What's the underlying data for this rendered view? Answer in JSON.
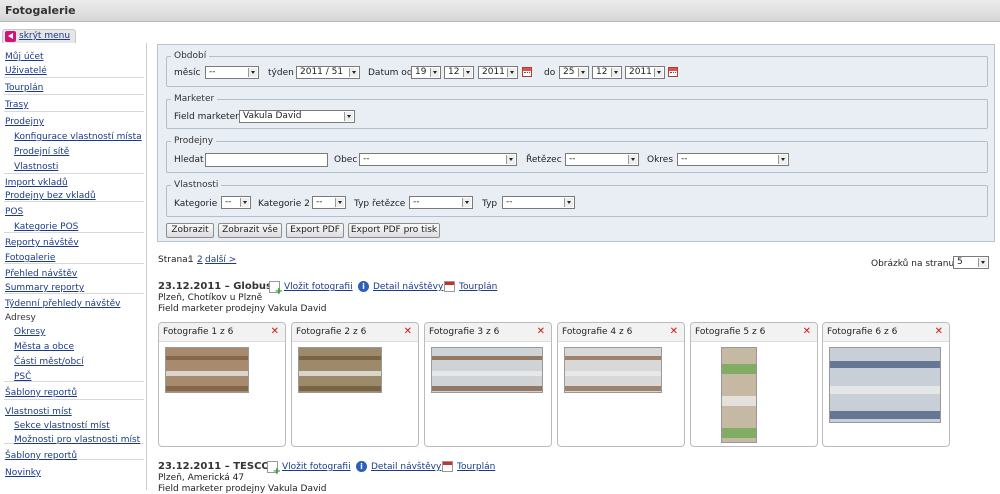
{
  "app": {
    "title": "Fotogalerie"
  },
  "sidebar": {
    "hide_label": "skrýt menu",
    "items": [
      {
        "label": "Můj účet",
        "link": true,
        "indent": false
      },
      {
        "label": "Uživatelé",
        "link": true,
        "indent": false
      },
      {
        "label": "Tourplán",
        "link": true,
        "indent": false
      },
      {
        "label": "Trasy",
        "link": true,
        "indent": false
      },
      {
        "label": "Prodejny",
        "link": true,
        "indent": false
      },
      {
        "label": "Konfigurace vlastností místa",
        "link": true,
        "indent": true
      },
      {
        "label": "Prodejní sítě",
        "link": true,
        "indent": true
      },
      {
        "label": "Vlastnosti",
        "link": true,
        "indent": true
      },
      {
        "label": "Import vkladů",
        "link": true,
        "indent": false
      },
      {
        "label": "Prodejny bez vkladů",
        "link": true,
        "indent": false
      },
      {
        "label": "POS",
        "link": true,
        "indent": false
      },
      {
        "label": "Kategorie POS",
        "link": true,
        "indent": true
      },
      {
        "label": "Reporty návštěv",
        "link": true,
        "indent": false
      },
      {
        "label": "Fotogalerie",
        "link": true,
        "indent": false
      },
      {
        "label": "Přehled návštěv",
        "link": true,
        "indent": false
      },
      {
        "label": "Summary reporty",
        "link": true,
        "indent": false
      },
      {
        "label": "Týdenní přehledy návštěv",
        "link": true,
        "indent": false
      },
      {
        "label": "Adresy",
        "link": false,
        "indent": false
      },
      {
        "label": "Okresy",
        "link": true,
        "indent": true
      },
      {
        "label": "Města a obce",
        "link": true,
        "indent": true
      },
      {
        "label": "Části měst/obcí",
        "link": true,
        "indent": true
      },
      {
        "label": "PSČ",
        "link": true,
        "indent": true
      },
      {
        "label": "Šablony reportů",
        "link": true,
        "indent": false
      },
      {
        "label": "Vlastnosti míst",
        "link": true,
        "indent": false
      },
      {
        "label": "Sekce vlastností míst",
        "link": true,
        "indent": true
      },
      {
        "label": "Možnosti pro vlastnosti míst",
        "link": true,
        "indent": true
      },
      {
        "label": "Šablony reportů",
        "link": true,
        "indent": false
      },
      {
        "label": "Novinky",
        "link": true,
        "indent": false
      }
    ]
  },
  "filter": {
    "obdobi": {
      "legend": "Období",
      "mesic_label": "měsíc",
      "mesic_value": "--",
      "tyden_label": "týden",
      "tyden_value": "2011 / 51",
      "datum_od_label": "Datum od",
      "od_day": "19",
      "od_month": "12",
      "od_year": "2011",
      "do_label": "do",
      "do_day": "25",
      "do_month": "12",
      "do_year": "2011"
    },
    "marketer": {
      "legend": "Marketer",
      "field_label": "Field marketer",
      "field_value": "Vakula David"
    },
    "prodejny": {
      "legend": "Prodejny",
      "hledat_label": "Hledat",
      "hledat_value": "",
      "obec_label": "Obec",
      "obec_value": "--",
      "retezec_label": "Řetězec",
      "retezec_value": "--",
      "okres_label": "Okres",
      "okres_value": "--"
    },
    "vlastnosti": {
      "legend": "Vlastnosti",
      "kategorie_label": "Kategorie",
      "kategorie_value": "--",
      "kategorie2_label": "Kategorie 2",
      "kategorie2_value": "--",
      "typ_retezce_label": "Typ řetězce",
      "typ_retezce_value": "--",
      "typ_label": "Typ",
      "typ_value": "--"
    },
    "buttons": {
      "zobrazit": "Zobrazit",
      "zobrazit_vse": "Zobrazit vše",
      "export_pdf": "Export PDF",
      "export_pdf_tisk": "Export PDF pro tisk"
    }
  },
  "pager": {
    "label": "Strana:",
    "page1": "1",
    "page2": "2",
    "next": "další >",
    "per_page_label": "Obrázků na stranu",
    "per_page_value": "5"
  },
  "visits": [
    {
      "title": "23.12.2011 – Globus",
      "address": "Plzeň, Chotíkov u Plzně",
      "marketer": "Field marketer prodejny Vakula David",
      "add_photo": "Vložit fotografii",
      "detail": "Detail návštěvy",
      "tourplan": "Tourplán",
      "photos": [
        "Fotografie 1 z 6",
        "Fotografie 2 z 6",
        "Fotografie 3 z 6",
        "Fotografie 4 z 6",
        "Fotografie 5 z 6",
        "Fotografie 6 z 6"
      ]
    },
    {
      "title": "23.12.2011 – TESCO",
      "address": "Plzeň, Americká 47",
      "marketer": "Field marketer prodejny Vakula David",
      "add_photo": "Vložit fotografii",
      "detail": "Detail návštěvy",
      "tourplan": "Tourplán"
    }
  ],
  "colors": {
    "filter_bg": "#e9eef5",
    "link": "#1a3a8a",
    "delete": "#dd1111",
    "hide_icon": "#d0157a"
  }
}
